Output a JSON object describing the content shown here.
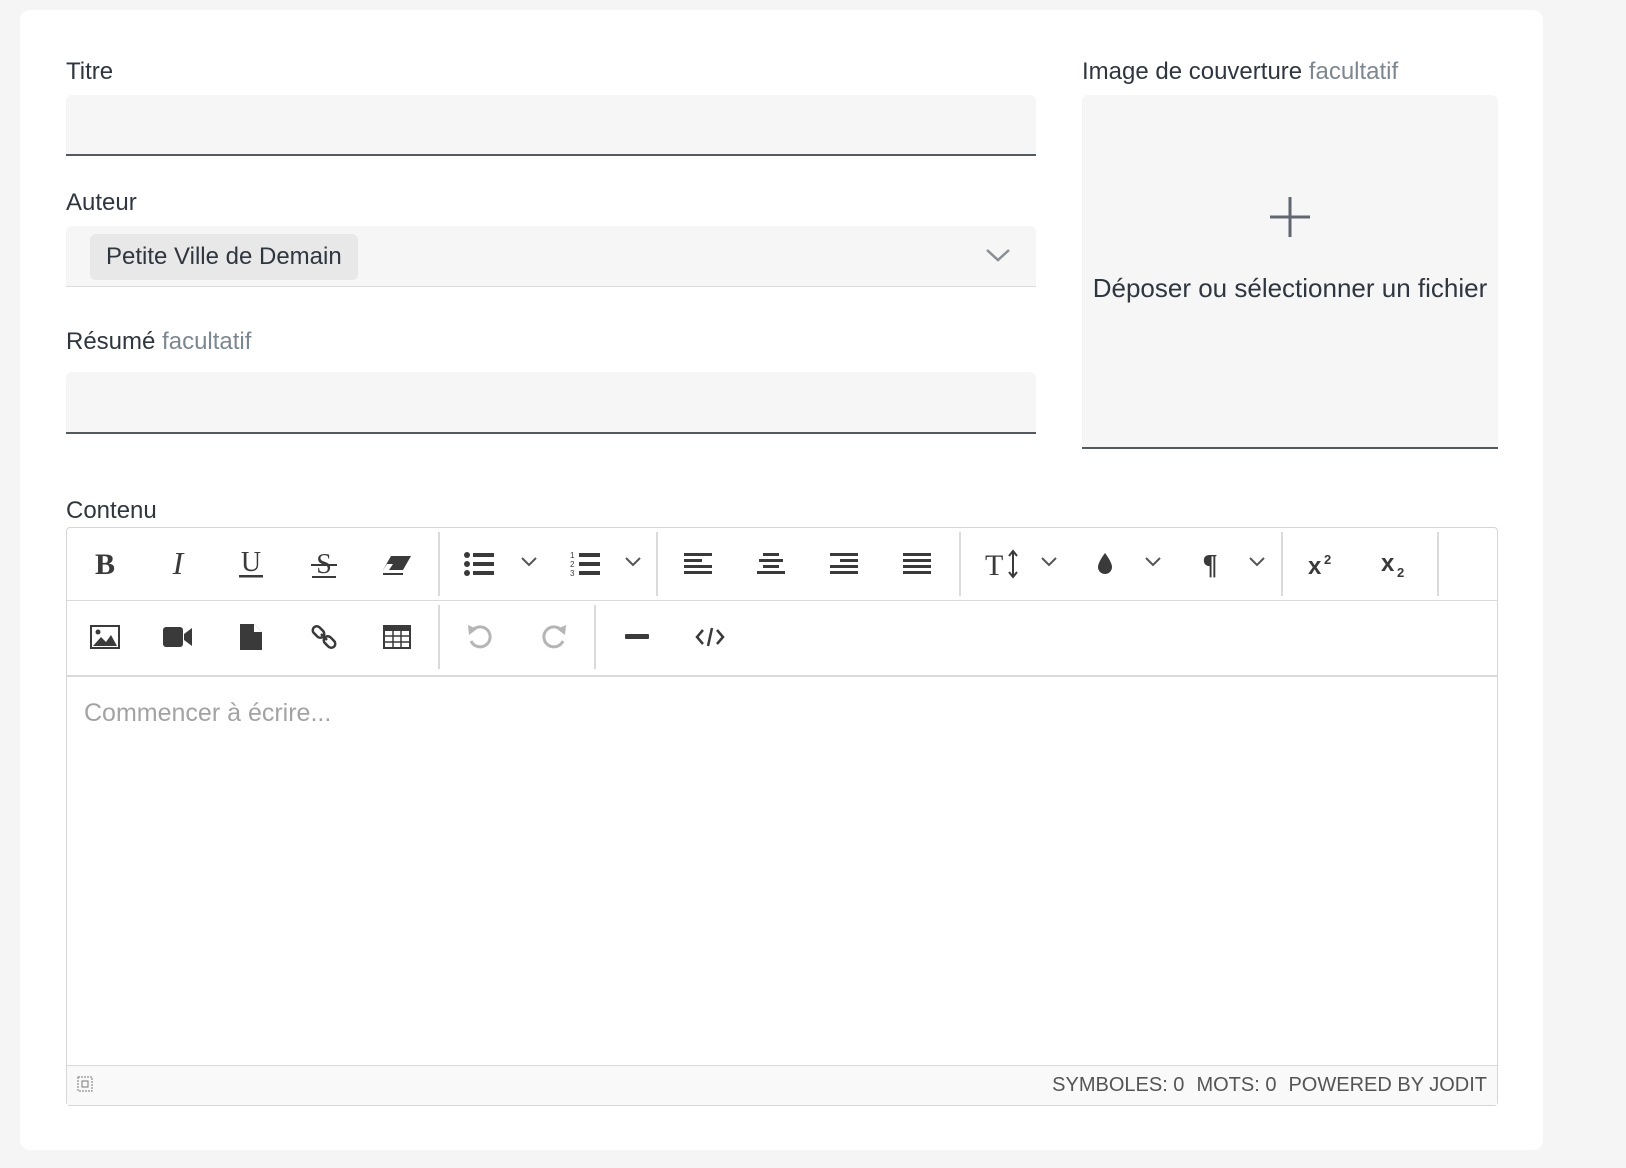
{
  "form": {
    "title_label": "Titre",
    "title_value": "",
    "author_label": "Auteur",
    "author_value": "Petite Ville de Demain",
    "summary_label": "Résumé",
    "summary_optional": "facultatif",
    "summary_value": "",
    "cover_label": "Image de couverture",
    "cover_optional": "facultatif",
    "cover_drop_text": "Déposer ou sélectionner un fichier",
    "content_label": "Contenu"
  },
  "editor": {
    "placeholder": "Commencer à écrire...",
    "status": {
      "symbols": "SYMBOLES: 0",
      "words": "MOTS: 0",
      "powered": "POWERED BY JODIT"
    },
    "toolbar_row1": [
      "bold-icon",
      "italic-icon",
      "underline-icon",
      "strikethrough-icon",
      "eraser-icon",
      "bullet-list-icon",
      "numbered-list-icon",
      "align-left-icon",
      "align-center-icon",
      "align-right-icon",
      "align-justify-icon",
      "font-size-icon",
      "color-drop-icon",
      "paragraph-icon",
      "superscript-icon",
      "subscript-icon"
    ],
    "toolbar_row2": [
      "image-icon",
      "video-icon",
      "file-icon",
      "link-icon",
      "table-icon",
      "undo-icon",
      "redo-icon",
      "horizontal-rule-icon",
      "source-code-icon"
    ]
  },
  "colors": {
    "page_bg": "#f5f5f5",
    "field_bg": "#f6f6f6",
    "field_border": "#525a62",
    "optional_text": "#7c8790",
    "icon": "#3a3a3a",
    "icon_disabled": "#b5b5b5"
  }
}
